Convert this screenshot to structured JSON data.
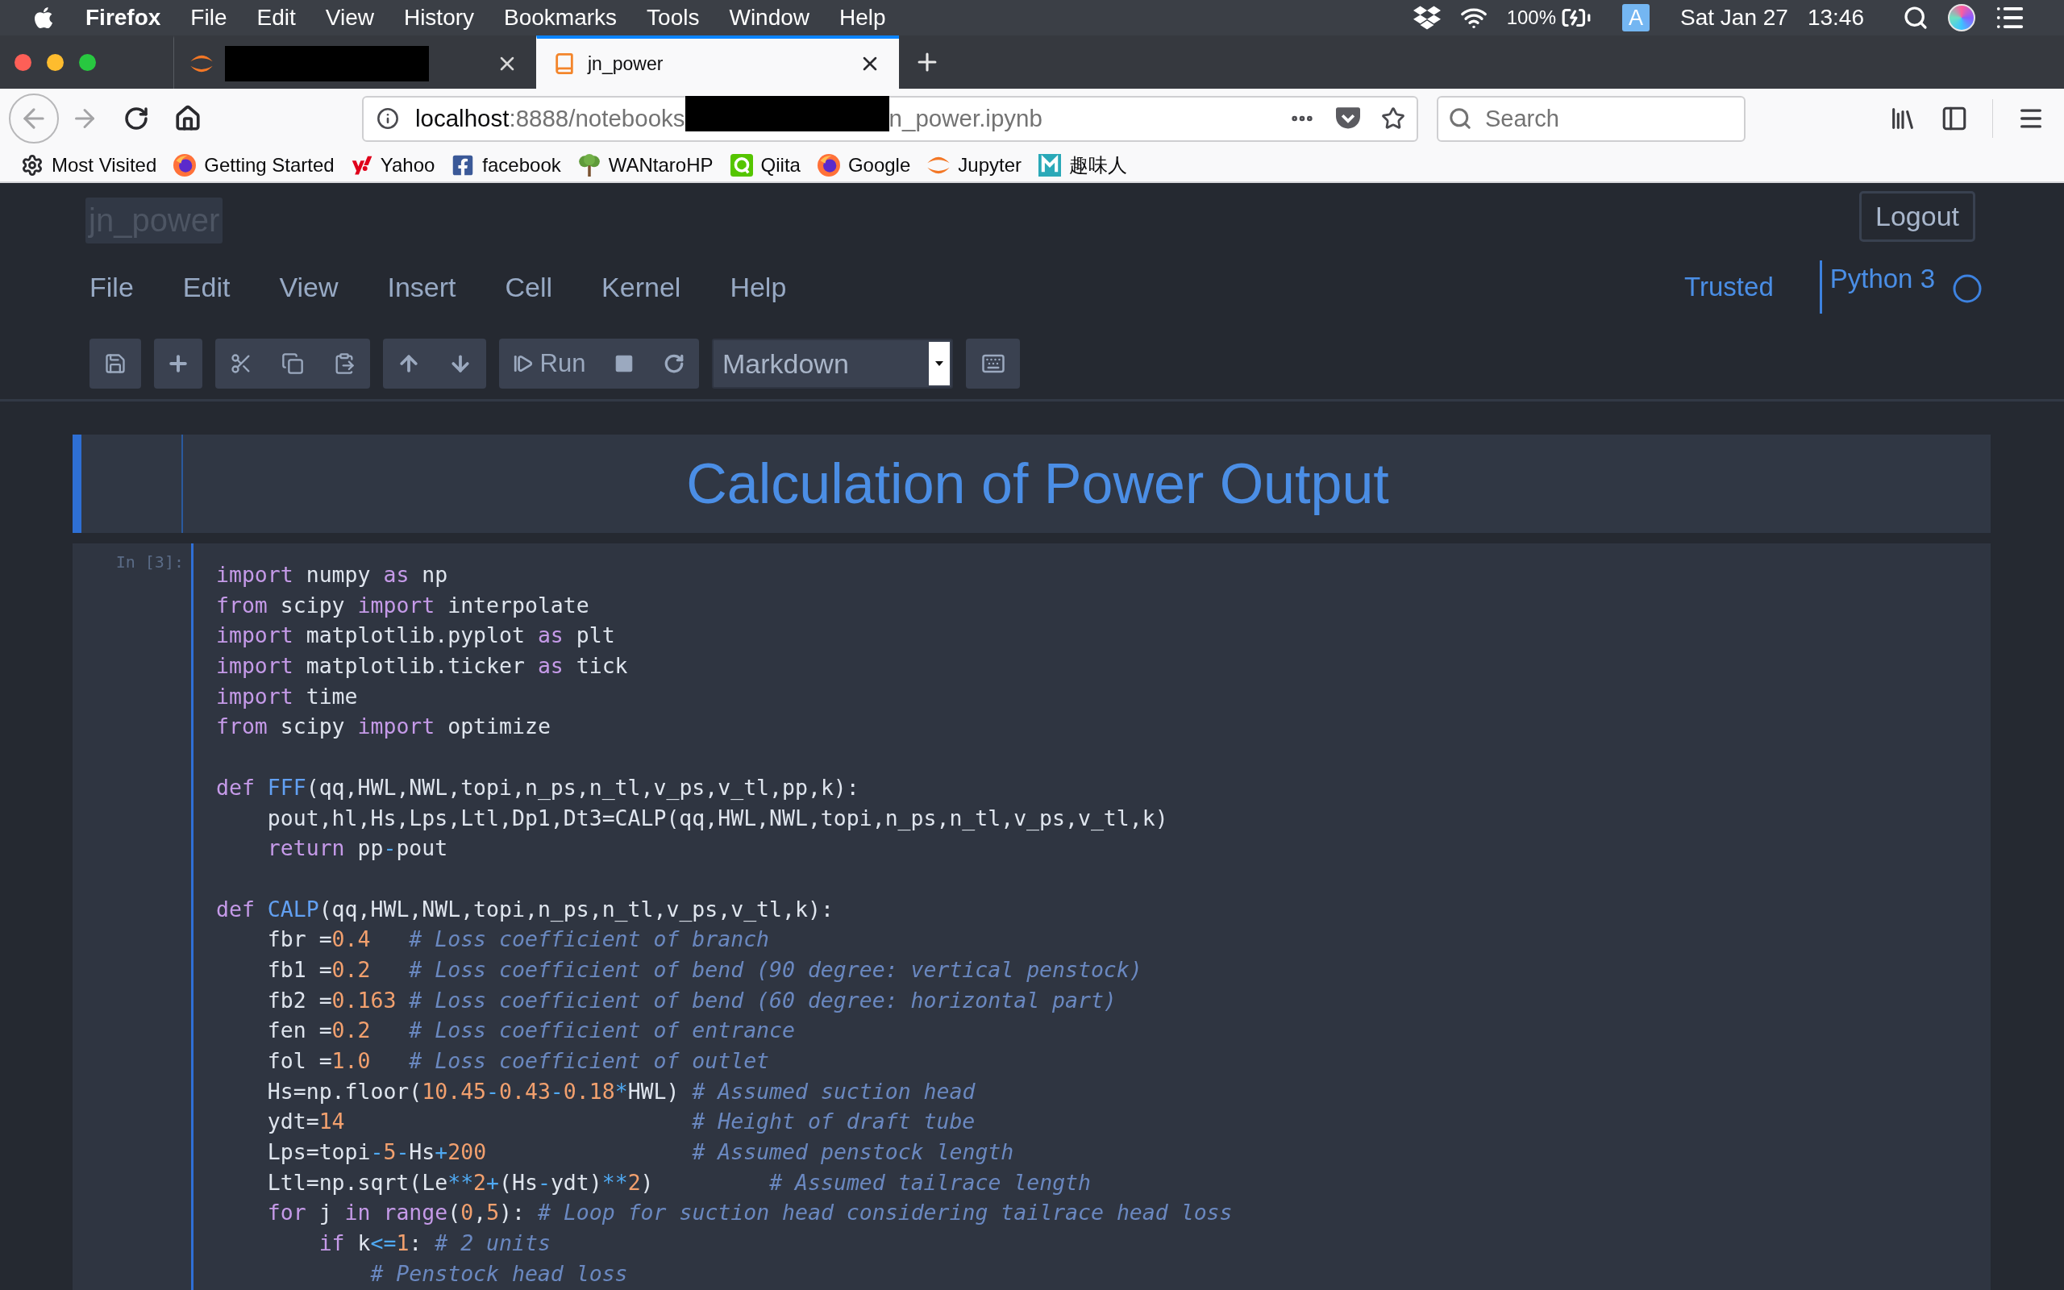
{
  "menubar": {
    "app": "Firefox",
    "items": [
      "File",
      "Edit",
      "View",
      "History",
      "Bookmarks",
      "Tools",
      "Window",
      "Help"
    ],
    "battery": "100%",
    "input_source": "A",
    "date": "Sat Jan 27",
    "time": "13:46"
  },
  "tabs": [
    {
      "kind": "jupyter",
      "title_hidden": true,
      "selected": false
    },
    {
      "kind": "notebook",
      "title": "jn_power",
      "selected": true
    }
  ],
  "nav_buttons": [
    {
      "kind": "back",
      "disabled": true
    },
    {
      "kind": "forward",
      "disabled": true
    },
    {
      "kind": "reload",
      "disabled": false
    },
    {
      "kind": "home",
      "disabled": false
    }
  ],
  "url": {
    "host": "localhost",
    "path": ":8888/notebooks",
    "hidden_part": true,
    "tail": "n_power.ipynb"
  },
  "search": {
    "placeholder": "Search"
  },
  "bookmarks": [
    {
      "kind": "gear",
      "label": "Most Visited"
    },
    {
      "kind": "firefox",
      "label": "Getting Started"
    },
    {
      "kind": "yahoo",
      "label": "Yahoo"
    },
    {
      "kind": "facebook",
      "label": "facebook"
    },
    {
      "kind": "tree",
      "label": "WANtaroHP"
    },
    {
      "kind": "qiita",
      "label": "Qiita"
    },
    {
      "kind": "firefox",
      "label": "Google"
    },
    {
      "kind": "jupyter",
      "label": "Jupyter"
    },
    {
      "kind": "mosaic",
      "label": "趣味人"
    }
  ],
  "notebook": {
    "title": "jn_power",
    "logout": "Logout",
    "menu": [
      "File",
      "Edit",
      "View",
      "Insert",
      "Cell",
      "Kernel",
      "Help"
    ],
    "trusted": "Trusted",
    "kernel": {
      "name": "Python 3",
      "busy": false
    },
    "toolbar": {
      "run": "Run",
      "cell_type": "Markdown"
    }
  },
  "cells": [
    {
      "kind": "markdown",
      "selected": true,
      "heading": "Calculation of Power Output"
    },
    {
      "kind": "code",
      "selected": false,
      "prompt": "In [3]:",
      "blocks": [
        {
          "lines": [
            {
              "tokens": [
                {
                  "text": "import",
                  "kind": "keyword"
                },
                {
                  "text": " numpy ",
                  "kind": "plain"
                },
                {
                  "text": "as",
                  "kind": "keyword"
                },
                {
                  "text": " np",
                  "kind": "plain"
                }
              ]
            },
            {
              "tokens": [
                {
                  "text": "from",
                  "kind": "keyword"
                },
                {
                  "text": " scipy ",
                  "kind": "plain"
                },
                {
                  "text": "import",
                  "kind": "keyword"
                },
                {
                  "text": " interpolate",
                  "kind": "plain"
                }
              ]
            },
            {
              "tokens": [
                {
                  "text": "import",
                  "kind": "keyword"
                },
                {
                  "text": " matplotlib.pyplot ",
                  "kind": "plain"
                },
                {
                  "text": "as",
                  "kind": "keyword"
                },
                {
                  "text": " plt",
                  "kind": "plain"
                }
              ]
            },
            {
              "tokens": [
                {
                  "text": "import",
                  "kind": "keyword"
                },
                {
                  "text": " matplotlib.ticker ",
                  "kind": "plain"
                },
                {
                  "text": "as",
                  "kind": "keyword"
                },
                {
                  "text": " tick",
                  "kind": "plain"
                }
              ]
            },
            {
              "tokens": [
                {
                  "text": "import",
                  "kind": "keyword"
                },
                {
                  "text": " time",
                  "kind": "plain"
                }
              ]
            },
            {
              "tokens": [
                {
                  "text": "from",
                  "kind": "keyword"
                },
                {
                  "text": " scipy ",
                  "kind": "plain"
                },
                {
                  "text": "import",
                  "kind": "keyword"
                },
                {
                  "text": " optimize",
                  "kind": "plain"
                }
              ]
            }
          ]
        },
        {
          "lines": [
            {
              "tokens": [
                {
                  "text": "def",
                  "kind": "keyword"
                },
                {
                  "text": " FFF",
                  "kind": "function"
                },
                {
                  "text": "(qq,HWL,NWL,topi,n_ps,n_tl,v_ps,v_tl,pp,k):",
                  "kind": "plain"
                }
              ]
            },
            {
              "tokens": [
                {
                  "text": "    pout,hl,Hs,Lps,Ltl,Dp1,Dt3=CALP(qq,HWL,NWL,topi,n_ps,n_tl,v_ps,v_tl,k)",
                  "kind": "plain"
                }
              ]
            },
            {
              "tokens": [
                {
                  "text": "    return",
                  "kind": "keyword"
                },
                {
                  "text": " pp",
                  "kind": "plain"
                },
                {
                  "text": "-",
                  "kind": "operator"
                },
                {
                  "text": "pout",
                  "kind": "plain"
                }
              ]
            }
          ]
        },
        {
          "lines": [
            {
              "tokens": [
                {
                  "text": "def",
                  "kind": "keyword"
                },
                {
                  "text": " CALP",
                  "kind": "function"
                },
                {
                  "text": "(qq,HWL,NWL,topi,n_ps,n_tl,v_ps,v_tl,k):",
                  "kind": "plain"
                }
              ]
            },
            {
              "tokens": [
                {
                  "text": "    fbr =",
                  "kind": "plain"
                },
                {
                  "text": "0.4",
                  "kind": "number"
                },
                {
                  "text": "   # Loss coefficient of branch",
                  "kind": "comment"
                }
              ]
            },
            {
              "tokens": [
                {
                  "text": "    fb1 =",
                  "kind": "plain"
                },
                {
                  "text": "0.2",
                  "kind": "number"
                },
                {
                  "text": "   # Loss coefficient of bend (90 degree: vertical penstock)",
                  "kind": "comment"
                }
              ]
            },
            {
              "tokens": [
                {
                  "text": "    fb2 =",
                  "kind": "plain"
                },
                {
                  "text": "0.163",
                  "kind": "number"
                },
                {
                  "text": " # Loss coefficient of bend (60 degree: horizontal part)",
                  "kind": "comment"
                }
              ]
            },
            {
              "tokens": [
                {
                  "text": "    fen =",
                  "kind": "plain"
                },
                {
                  "text": "0.2",
                  "kind": "number"
                },
                {
                  "text": "   # Loss coefficient of entrance",
                  "kind": "comment"
                }
              ]
            },
            {
              "tokens": [
                {
                  "text": "    fol =",
                  "kind": "plain"
                },
                {
                  "text": "1.0",
                  "kind": "number"
                },
                {
                  "text": "   # Loss coefficient of outlet",
                  "kind": "comment"
                }
              ]
            },
            {
              "tokens": [
                {
                  "text": "    Hs=np.floor(",
                  "kind": "plain"
                },
                {
                  "text": "10.45",
                  "kind": "number"
                },
                {
                  "text": "-",
                  "kind": "operator"
                },
                {
                  "text": "0.43",
                  "kind": "number"
                },
                {
                  "text": "-",
                  "kind": "operator"
                },
                {
                  "text": "0.18",
                  "kind": "number"
                },
                {
                  "text": "*",
                  "kind": "operator"
                },
                {
                  "text": "HWL)",
                  "kind": "plain"
                },
                {
                  "text": " # Assumed suction head",
                  "kind": "comment"
                }
              ]
            },
            {
              "tokens": [
                {
                  "text": "    ydt=",
                  "kind": "plain"
                },
                {
                  "text": "14",
                  "kind": "number"
                },
                {
                  "text": "                           # Height of draft tube",
                  "kind": "comment"
                }
              ]
            },
            {
              "tokens": [
                {
                  "text": "    Lps=topi",
                  "kind": "plain"
                },
                {
                  "text": "-",
                  "kind": "operator"
                },
                {
                  "text": "5",
                  "kind": "number"
                },
                {
                  "text": "-",
                  "kind": "operator"
                },
                {
                  "text": "Hs",
                  "kind": "plain"
                },
                {
                  "text": "+",
                  "kind": "operator"
                },
                {
                  "text": "200",
                  "kind": "number"
                },
                {
                  "text": "                # Assumed penstock length",
                  "kind": "comment"
                }
              ]
            },
            {
              "tokens": [
                {
                  "text": "    Ltl=np.sqrt(Le",
                  "kind": "plain"
                },
                {
                  "text": "**",
                  "kind": "operator"
                },
                {
                  "text": "2",
                  "kind": "number"
                },
                {
                  "text": "+",
                  "kind": "operator"
                },
                {
                  "text": "(Hs",
                  "kind": "plain"
                },
                {
                  "text": "-",
                  "kind": "operator"
                },
                {
                  "text": "ydt)",
                  "kind": "plain"
                },
                {
                  "text": "**",
                  "kind": "operator"
                },
                {
                  "text": "2",
                  "kind": "number"
                },
                {
                  "text": ")",
                  "kind": "plain"
                },
                {
                  "text": "         # Assumed tailrace length",
                  "kind": "comment"
                }
              ]
            },
            {
              "tokens": [
                {
                  "text": "    for",
                  "kind": "keyword"
                },
                {
                  "text": " j ",
                  "kind": "plain"
                },
                {
                  "text": "in",
                  "kind": "keyword"
                },
                {
                  "text": " range",
                  "kind": "builtin"
                },
                {
                  "text": "(",
                  "kind": "plain"
                },
                {
                  "text": "0",
                  "kind": "number"
                },
                {
                  "text": ",",
                  "kind": "plain"
                },
                {
                  "text": "5",
                  "kind": "number"
                },
                {
                  "text": "): ",
                  "kind": "plain"
                },
                {
                  "text": "# Loop for suction head considering tailrace head loss",
                  "kind": "comment"
                }
              ]
            },
            {
              "tokens": [
                {
                  "text": "        if",
                  "kind": "keyword"
                },
                {
                  "text": " k",
                  "kind": "plain"
                },
                {
                  "text": "<=",
                  "kind": "operator"
                },
                {
                  "text": "1",
                  "kind": "number"
                },
                {
                  "text": ": ",
                  "kind": "plain"
                },
                {
                  "text": "# 2 units",
                  "kind": "comment"
                }
              ]
            },
            {
              "tokens": [
                {
                  "text": "            # Penstock head loss",
                  "kind": "comment"
                }
              ]
            }
          ]
        }
      ]
    }
  ]
}
